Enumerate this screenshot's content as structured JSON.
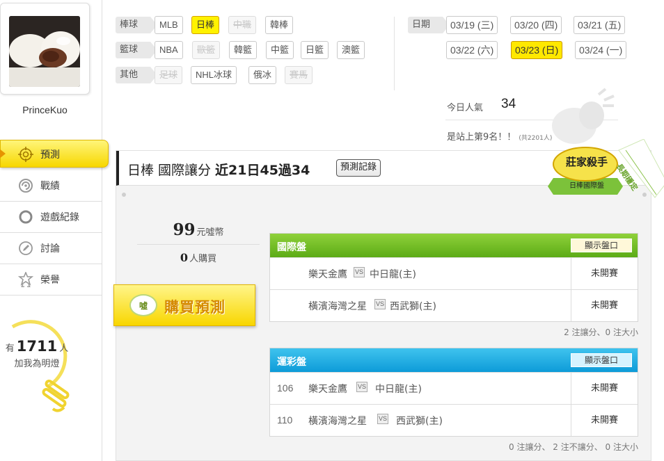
{
  "user": {
    "name": "PrinceKuo"
  },
  "nav": [
    {
      "label": "預測",
      "icon": "target-icon",
      "active": true
    },
    {
      "label": "戰績",
      "icon": "record-swirl-icon",
      "active": false
    },
    {
      "label": "遊戲紀錄",
      "icon": "ring-icon",
      "active": false
    },
    {
      "label": "討論",
      "icon": "pencil-bubble-icon",
      "active": false
    },
    {
      "label": "榮譽",
      "icon": "medal-icon",
      "active": false
    }
  ],
  "fans": {
    "prefix": "有",
    "count": "1711",
    "suffix": "人",
    "line2": "加我為明燈"
  },
  "sports": {
    "baseball": {
      "label": "棒球",
      "items": [
        "MLB",
        "日棒",
        "中職",
        "韓棒"
      ]
    },
    "basketball": {
      "label": "籃球",
      "items": [
        "NBA",
        "歐籃",
        "韓籃",
        "中籃",
        "日籃",
        "澳籃"
      ]
    },
    "other": {
      "label": "其他",
      "items": [
        "足球",
        "NHL冰球",
        "俄冰",
        "賽馬"
      ]
    }
  },
  "dates": {
    "label": "日期",
    "items": [
      "03/19 (三)",
      "03/20 (四)",
      "03/21 (五)",
      "03/22 (六)",
      "03/23 (日)",
      "03/24 (一)"
    ],
    "selected": "03/23 (日)"
  },
  "popularity": {
    "label": "今日人氣",
    "value": "34"
  },
  "rank": {
    "text": "是站上第9名！！",
    "total": "(共2201人)"
  },
  "badge": {
    "line1": "莊家殺手",
    "line2": "日棒國際盤",
    "ribbon": "長期穩定"
  },
  "card": {
    "title": "日棒 國際讓分",
    "stats": "近21日45過34",
    "record_button": "預測記錄",
    "price_value": "99",
    "price_unit": "元噓幣",
    "buyers_value": "0",
    "buyers_unit": "人購買",
    "buy_button": "購買預測",
    "buy_icon_text": "噓"
  },
  "intl": {
    "title": "國際盤",
    "show_button": "顯示盤口",
    "rows": [
      {
        "team_a": "樂天金鷹",
        "vs": "VS",
        "team_b": "中日龍(主)",
        "status": "未開賽"
      },
      {
        "team_a": "橫濱海灣之星",
        "vs": "VS",
        "team_b": "西武獅(主)",
        "status": "未開賽"
      }
    ],
    "footer": "2 注讓分、0 注大小"
  },
  "lottery": {
    "title": "運彩盤",
    "show_button": "顯示盤口",
    "rows": [
      {
        "num": "106",
        "team_a": "樂天金鷹",
        "vs": "VS",
        "team_b": "中日龍(主)",
        "status": "未開賽"
      },
      {
        "num": "110",
        "team_a": "橫濱海灣之星",
        "vs": "VS",
        "team_b": "西武獅(主)",
        "status": "未開賽"
      }
    ],
    "footer": "0 注讓分、 2 注不讓分、 0 注大小"
  },
  "colors": {
    "accent_yellow": "#fff200",
    "intl_green": "#5cab16",
    "lottery_blue": "#0d9bd8"
  }
}
